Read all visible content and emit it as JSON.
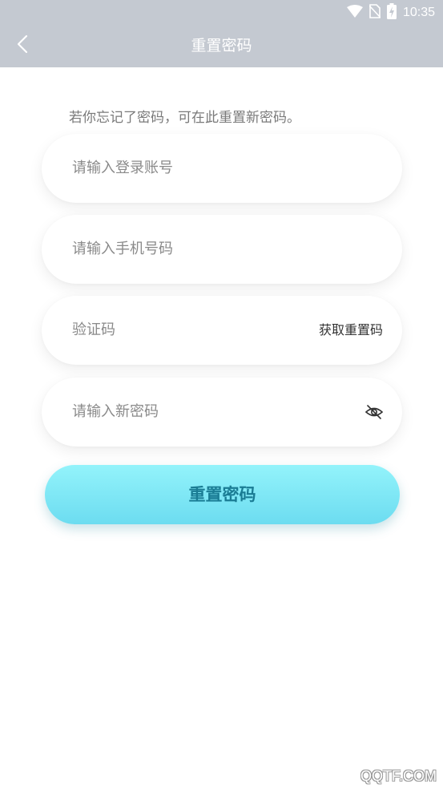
{
  "status_bar": {
    "time": "10:35",
    "icons": [
      "wifi-icon",
      "no-sim-icon",
      "battery-charging-icon"
    ]
  },
  "header": {
    "back_icon": "chevron-left-icon",
    "title": "重置密码"
  },
  "form": {
    "hint": "若你忘记了密码，可在此重置新密码。",
    "account_placeholder": "请输入登录账号",
    "phone_placeholder": "请输入手机号码",
    "code_placeholder": "验证码",
    "get_code_label": "获取重置码",
    "password_placeholder": "请输入新密码",
    "password_toggle_icon": "eye-off-icon",
    "submit_label": "重置密码"
  },
  "watermark": "QQTF.COM",
  "colors": {
    "header_bg": "#c4c9d1",
    "button_gradient_top": "#93f3fb",
    "button_gradient_bottom": "#6cdcf0",
    "button_text": "#1a7c94"
  }
}
